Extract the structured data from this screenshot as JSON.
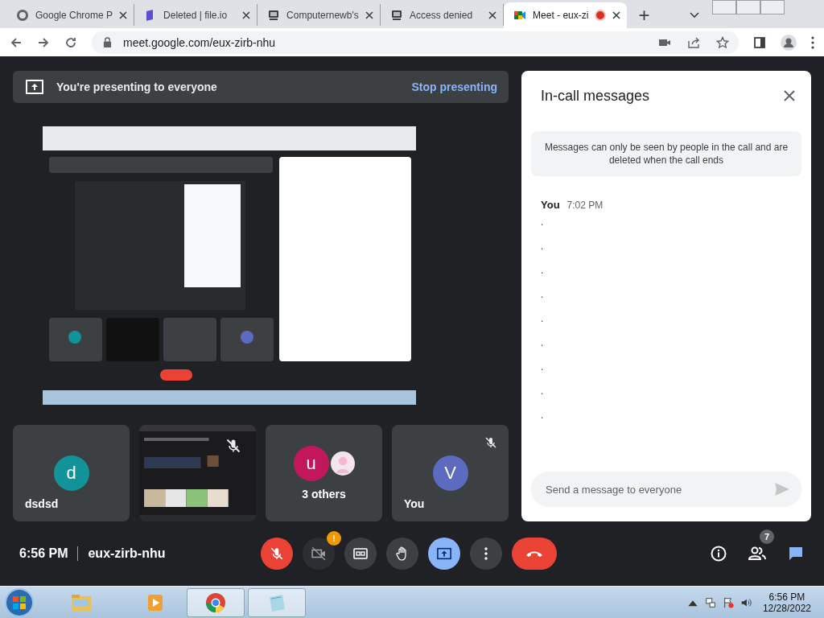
{
  "browser": {
    "tabs": [
      {
        "kind": "globe",
        "title": "Google Chrome P",
        "selected": false,
        "recording": false
      },
      {
        "kind": "doc",
        "title": "Deleted | file.io",
        "selected": false,
        "recording": false
      },
      {
        "kind": "app",
        "title": "Computernewb's",
        "selected": false,
        "recording": false
      },
      {
        "kind": "app",
        "title": "Access denied",
        "selected": false,
        "recording": false
      },
      {
        "kind": "meet",
        "title": "Meet - eux-zi",
        "selected": true,
        "recording": true
      }
    ],
    "new_tab": "+",
    "address": "meet.google.com/eux-zirb-nhu"
  },
  "banner": {
    "text": "You're presenting to everyone",
    "action": "Stop presenting"
  },
  "shared_screen": {
    "kind": "picture"
  },
  "tiles": [
    {
      "kind": "avatar",
      "name": "dsdsd",
      "initial": "d",
      "color": "#12939a",
      "muted": false
    },
    {
      "kind": "picture",
      "muted": true
    },
    {
      "kind": "group",
      "name": "3 others",
      "initial": "u",
      "color": "#c2185b",
      "muted": false
    },
    {
      "kind": "avatar",
      "name": "You",
      "initial": "V",
      "color": "#5c6bc0",
      "muted": true
    }
  ],
  "chat": {
    "title": "In-call messages",
    "notice": "Messages can only be seen by people in the call and are deleted when the call ends",
    "sender": "You",
    "time": "7:02 PM",
    "messages": [
      ".",
      ".",
      ".",
      ".",
      ".",
      ".",
      ".",
      ".",
      "."
    ],
    "placeholder": "Send a message to everyone"
  },
  "call_bar": {
    "time": "6:56 PM",
    "meeting": "eux-zirb-nhu",
    "controls": [
      {
        "kind": "mic",
        "on": false
      },
      {
        "kind": "camera",
        "on": false,
        "badge": "!"
      },
      {
        "kind": "captions",
        "on": false
      },
      {
        "kind": "hand",
        "on": false
      },
      {
        "kind": "present",
        "on": true
      },
      {
        "kind": "more",
        "on": false
      },
      {
        "kind": "hangup"
      }
    ],
    "people_count": "7"
  },
  "taskbar": {
    "time": "6:56 PM",
    "date": "12/28/2022"
  }
}
